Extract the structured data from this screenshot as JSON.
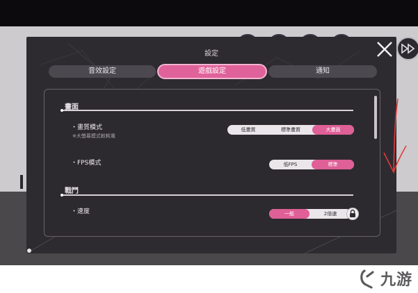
{
  "dialog": {
    "title": "設定"
  },
  "tabs": [
    {
      "label": "音效設定",
      "active": false
    },
    {
      "label": "遊戲設定",
      "active": true
    },
    {
      "label": "通知",
      "active": false
    }
  ],
  "sections": {
    "graphics": {
      "title": "畫面",
      "quality": {
        "label": "・畫質模式",
        "note": "※大螢幕模式較耗電",
        "options": [
          "低畫質",
          "標準畫質",
          "大畫面"
        ],
        "selected": "大畫面"
      },
      "fps": {
        "label": "・FPS模式",
        "options": [
          "低FPS",
          "標準"
        ],
        "selected": "標準"
      }
    },
    "battle": {
      "title": "戰鬥",
      "speed": {
        "label": "・速度",
        "options": [
          "一般",
          "2倍速"
        ],
        "selected": "一般"
      }
    }
  },
  "watermark": {
    "text": "九游"
  },
  "colors": {
    "accent": "#df5f97",
    "panel": "#2d2a2f",
    "annotation": "#e23a3a"
  },
  "icons": [
    "close-icon",
    "fast-forward-icon",
    "lock-icon",
    "annotation-arrow-icon",
    "watermark-logo-icon"
  ]
}
